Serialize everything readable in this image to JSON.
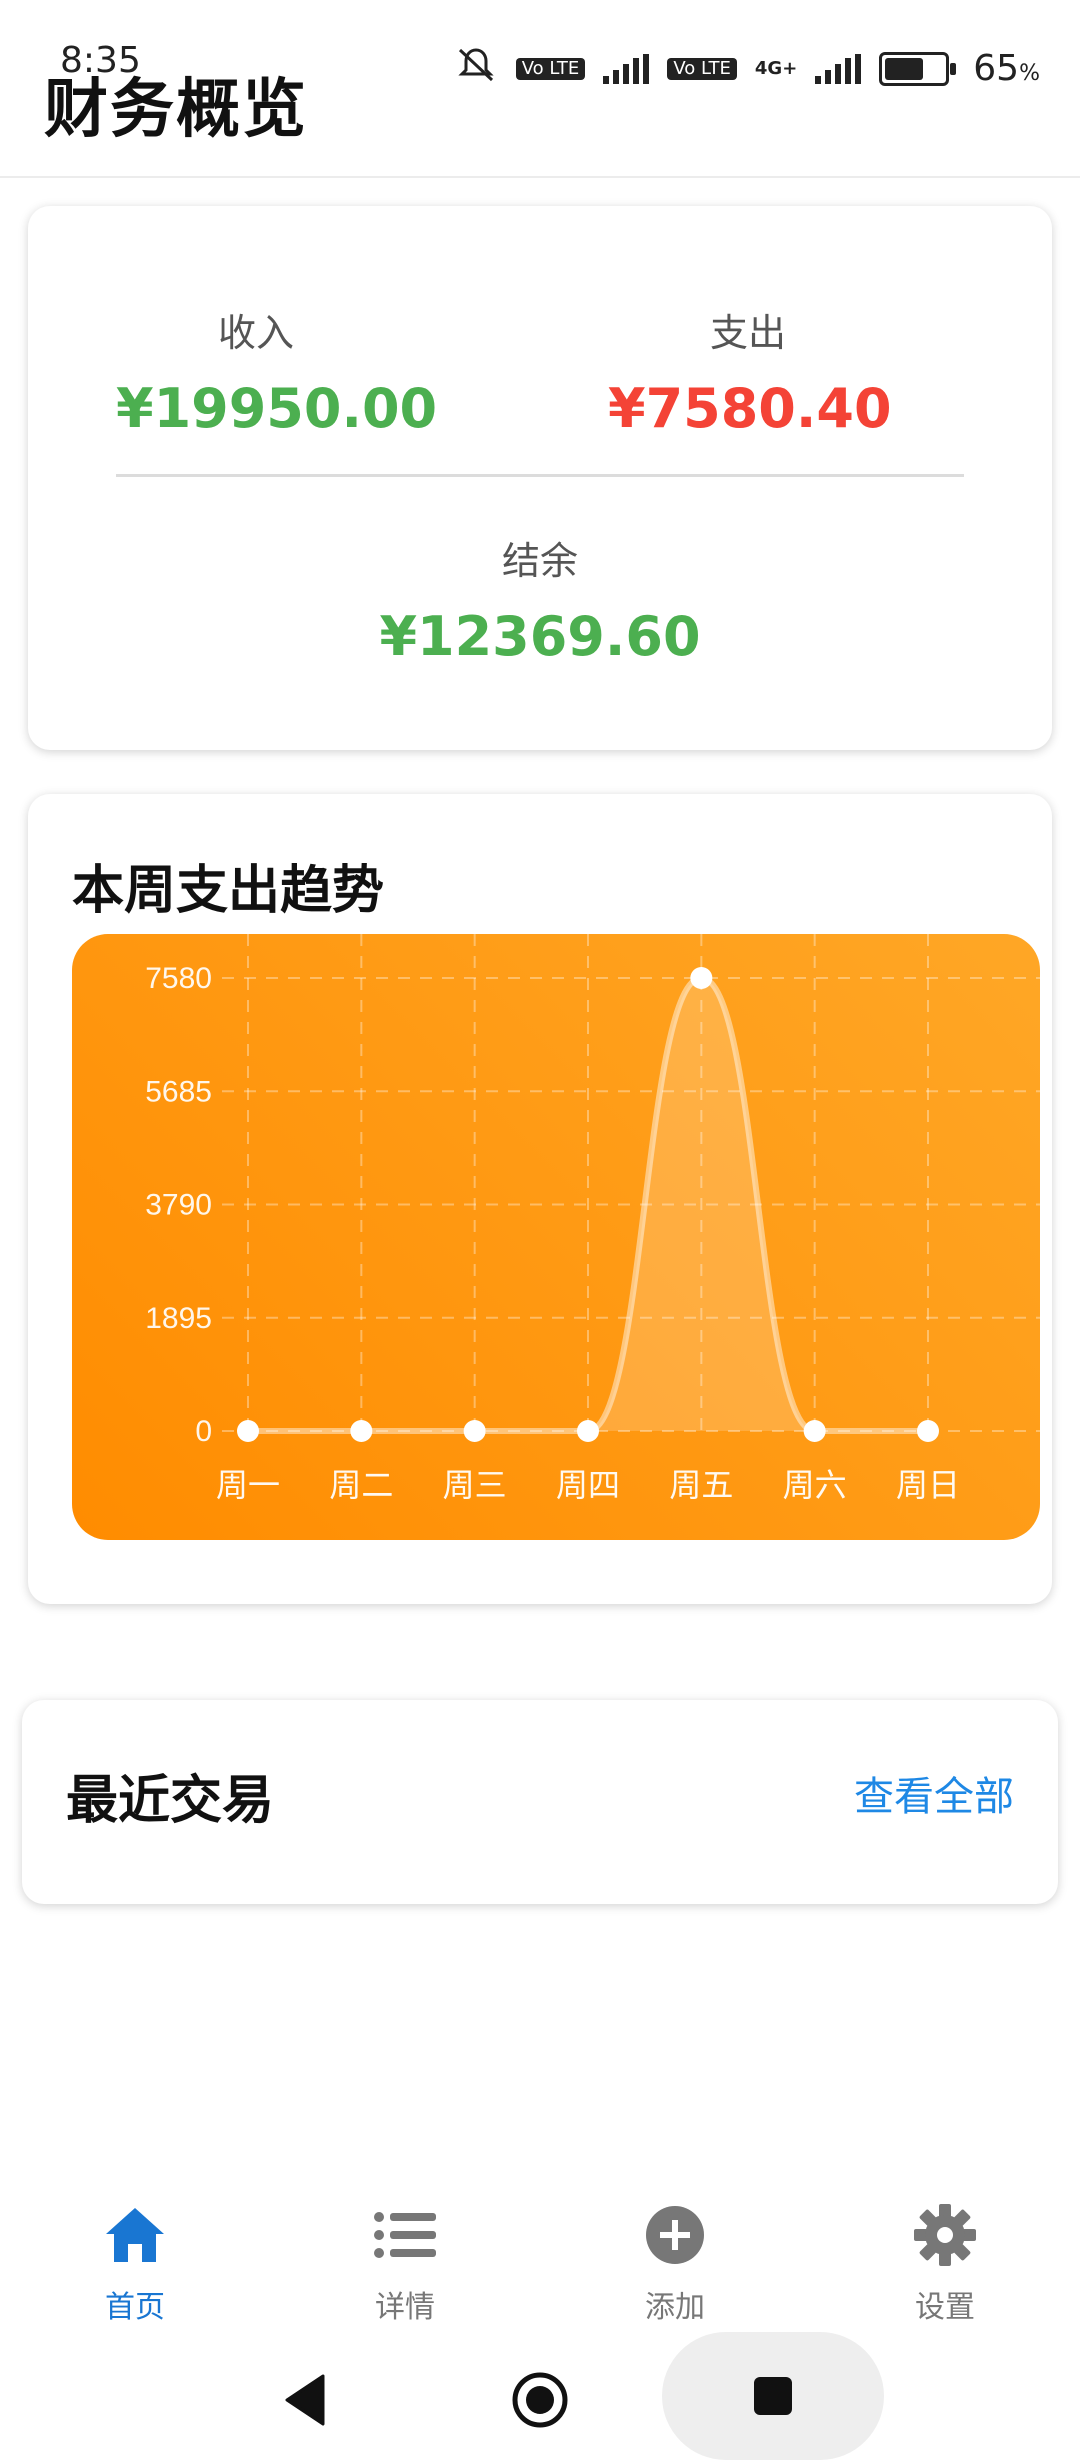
{
  "status_bar": {
    "time": "8:35",
    "volte1": "Vo LTE",
    "volte2": "Vo LTE",
    "network": "4G+",
    "battery": "65",
    "battery_unit": "%"
  },
  "header": {
    "title": "财务概览"
  },
  "summary": {
    "income_label": "收入",
    "income_value": "¥19950.00",
    "expense_label": "支出",
    "expense_value": "¥7580.40",
    "balance_label": "结余",
    "balance_value": "¥12369.60"
  },
  "trend": {
    "title": "本周支出趋势"
  },
  "chart_data": {
    "type": "area",
    "title": "本周支出趋势",
    "categories": [
      "周一",
      "周二",
      "周三",
      "周四",
      "周五",
      "周六",
      "周日"
    ],
    "values": [
      0,
      0,
      0,
      0,
      7580,
      0,
      0
    ],
    "yticks": [
      "0",
      "1895",
      "3790",
      "5685",
      "7580"
    ],
    "ylim": [
      0,
      7580
    ],
    "grid": true,
    "colors": {
      "background_start": "#ff8c00",
      "background_end": "#ffa726",
      "line": "#ffffff"
    }
  },
  "recent": {
    "title": "最近交易",
    "view_all": "查看全部"
  },
  "bottom_nav": [
    {
      "label": "首页",
      "icon": "home-icon",
      "active": true
    },
    {
      "label": "详情",
      "icon": "list-icon",
      "active": false
    },
    {
      "label": "添加",
      "icon": "add-circle-icon",
      "active": false
    },
    {
      "label": "设置",
      "icon": "gear-icon",
      "active": false
    }
  ],
  "colors": {
    "accent": "#1976d2",
    "income": "#4caf50",
    "expense": "#f44336",
    "link": "#1e88e5"
  }
}
